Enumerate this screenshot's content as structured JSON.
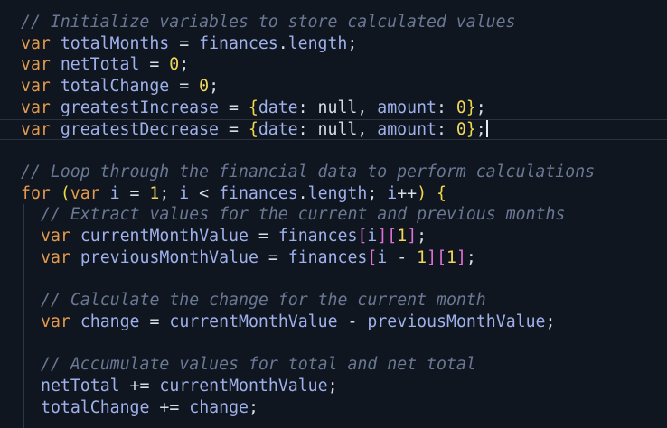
{
  "colors": {
    "background": "#0f1620",
    "keyword": "#e39a4d",
    "identifier": "#9fb0ea",
    "property": "#9fb0ea",
    "operator": "#d6dde8",
    "number": "#f0d75c",
    "punctuation": "#d6dde8",
    "comment": "#6a7893",
    "brace": "#eed84c",
    "bracket_outer": "#e070d8",
    "bracket_inner": "#58a6e6",
    "paren": "#eed84c",
    "null": "#d6dde8"
  },
  "editor": {
    "cursor_line": 6,
    "lines": [
      {
        "indent": 1,
        "tokens": [
          {
            "text": "// Initialize variables to store calculated values",
            "kind": "comment"
          }
        ]
      },
      {
        "indent": 1,
        "tokens": [
          {
            "text": "var",
            "kind": "keyword"
          },
          {
            "text": " ",
            "kind": "ws"
          },
          {
            "text": "totalMonths",
            "kind": "identifier"
          },
          {
            "text": " = ",
            "kind": "operator"
          },
          {
            "text": "finances",
            "kind": "identifier"
          },
          {
            "text": ".",
            "kind": "punctuation"
          },
          {
            "text": "length",
            "kind": "property"
          },
          {
            "text": ";",
            "kind": "punctuation"
          }
        ]
      },
      {
        "indent": 1,
        "tokens": [
          {
            "text": "var",
            "kind": "keyword"
          },
          {
            "text": " ",
            "kind": "ws"
          },
          {
            "text": "netTotal",
            "kind": "identifier"
          },
          {
            "text": " = ",
            "kind": "operator"
          },
          {
            "text": "0",
            "kind": "number"
          },
          {
            "text": ";",
            "kind": "punctuation"
          }
        ]
      },
      {
        "indent": 1,
        "tokens": [
          {
            "text": "var",
            "kind": "keyword"
          },
          {
            "text": " ",
            "kind": "ws"
          },
          {
            "text": "totalChange",
            "kind": "identifier"
          },
          {
            "text": " = ",
            "kind": "operator"
          },
          {
            "text": "0",
            "kind": "number"
          },
          {
            "text": ";",
            "kind": "punctuation"
          }
        ]
      },
      {
        "indent": 1,
        "tokens": [
          {
            "text": "var",
            "kind": "keyword"
          },
          {
            "text": " ",
            "kind": "ws"
          },
          {
            "text": "greatestIncrease",
            "kind": "identifier"
          },
          {
            "text": " = ",
            "kind": "operator"
          },
          {
            "text": "{",
            "kind": "brace"
          },
          {
            "text": "date",
            "kind": "property"
          },
          {
            "text": ": ",
            "kind": "punctuation"
          },
          {
            "text": "null",
            "kind": "null"
          },
          {
            "text": ", ",
            "kind": "punctuation"
          },
          {
            "text": "amount",
            "kind": "property"
          },
          {
            "text": ": ",
            "kind": "punctuation"
          },
          {
            "text": "0",
            "kind": "number"
          },
          {
            "text": "}",
            "kind": "brace"
          },
          {
            "text": ";",
            "kind": "punctuation"
          }
        ]
      },
      {
        "indent": 1,
        "tokens": [
          {
            "text": "var",
            "kind": "keyword"
          },
          {
            "text": " ",
            "kind": "ws"
          },
          {
            "text": "greatestDecrease",
            "kind": "identifier"
          },
          {
            "text": " = ",
            "kind": "operator"
          },
          {
            "text": "{",
            "kind": "brace"
          },
          {
            "text": "date",
            "kind": "property"
          },
          {
            "text": ": ",
            "kind": "punctuation"
          },
          {
            "text": "null",
            "kind": "null"
          },
          {
            "text": ", ",
            "kind": "punctuation"
          },
          {
            "text": "amount",
            "kind": "property"
          },
          {
            "text": ": ",
            "kind": "punctuation"
          },
          {
            "text": "0",
            "kind": "number"
          },
          {
            "text": "}",
            "kind": "brace"
          },
          {
            "text": ";",
            "kind": "punctuation"
          }
        ]
      },
      {
        "indent": 1,
        "tokens": []
      },
      {
        "indent": 1,
        "tokens": [
          {
            "text": "// Loop through the financial data to perform calculations",
            "kind": "comment"
          }
        ]
      },
      {
        "indent": 1,
        "tokens": [
          {
            "text": "for",
            "kind": "keyword"
          },
          {
            "text": " ",
            "kind": "ws"
          },
          {
            "text": "(",
            "kind": "paren"
          },
          {
            "text": "var",
            "kind": "keyword"
          },
          {
            "text": " ",
            "kind": "ws"
          },
          {
            "text": "i",
            "kind": "identifier"
          },
          {
            "text": " = ",
            "kind": "operator"
          },
          {
            "text": "1",
            "kind": "number"
          },
          {
            "text": "; ",
            "kind": "punctuation"
          },
          {
            "text": "i",
            "kind": "identifier"
          },
          {
            "text": " < ",
            "kind": "operator"
          },
          {
            "text": "finances",
            "kind": "identifier"
          },
          {
            "text": ".",
            "kind": "punctuation"
          },
          {
            "text": "length",
            "kind": "property"
          },
          {
            "text": "; ",
            "kind": "punctuation"
          },
          {
            "text": "i",
            "kind": "identifier"
          },
          {
            "text": "++",
            "kind": "operator"
          },
          {
            "text": ")",
            "kind": "paren"
          },
          {
            "text": " ",
            "kind": "ws"
          },
          {
            "text": "{",
            "kind": "brace"
          }
        ]
      },
      {
        "indent": 2,
        "tokens": [
          {
            "text": "// Extract values for the current and previous months",
            "kind": "comment"
          }
        ]
      },
      {
        "indent": 2,
        "tokens": [
          {
            "text": "var",
            "kind": "keyword"
          },
          {
            "text": " ",
            "kind": "ws"
          },
          {
            "text": "currentMonthValue",
            "kind": "identifier"
          },
          {
            "text": " = ",
            "kind": "operator"
          },
          {
            "text": "finances",
            "kind": "identifier"
          },
          {
            "text": "[",
            "kind": "bracket_outer"
          },
          {
            "text": "i",
            "kind": "identifier"
          },
          {
            "text": "]",
            "kind": "bracket_outer"
          },
          {
            "text": "[",
            "kind": "bracket_outer"
          },
          {
            "text": "1",
            "kind": "number"
          },
          {
            "text": "]",
            "kind": "bracket_outer"
          },
          {
            "text": ";",
            "kind": "punctuation"
          }
        ]
      },
      {
        "indent": 2,
        "tokens": [
          {
            "text": "var",
            "kind": "keyword"
          },
          {
            "text": " ",
            "kind": "ws"
          },
          {
            "text": "previousMonthValue",
            "kind": "identifier"
          },
          {
            "text": " = ",
            "kind": "operator"
          },
          {
            "text": "finances",
            "kind": "identifier"
          },
          {
            "text": "[",
            "kind": "bracket_outer"
          },
          {
            "text": "i",
            "kind": "identifier"
          },
          {
            "text": " - ",
            "kind": "operator"
          },
          {
            "text": "1",
            "kind": "number"
          },
          {
            "text": "]",
            "kind": "bracket_outer"
          },
          {
            "text": "[",
            "kind": "bracket_outer"
          },
          {
            "text": "1",
            "kind": "number"
          },
          {
            "text": "]",
            "kind": "bracket_outer"
          },
          {
            "text": ";",
            "kind": "punctuation"
          }
        ]
      },
      {
        "indent": 2,
        "tokens": []
      },
      {
        "indent": 2,
        "tokens": [
          {
            "text": "// Calculate the change for the current month",
            "kind": "comment"
          }
        ]
      },
      {
        "indent": 2,
        "tokens": [
          {
            "text": "var",
            "kind": "keyword"
          },
          {
            "text": " ",
            "kind": "ws"
          },
          {
            "text": "change",
            "kind": "identifier"
          },
          {
            "text": " = ",
            "kind": "operator"
          },
          {
            "text": "currentMonthValue",
            "kind": "identifier"
          },
          {
            "text": " - ",
            "kind": "operator"
          },
          {
            "text": "previousMonthValue",
            "kind": "identifier"
          },
          {
            "text": ";",
            "kind": "punctuation"
          }
        ]
      },
      {
        "indent": 2,
        "tokens": []
      },
      {
        "indent": 2,
        "tokens": [
          {
            "text": "// Accumulate values for total and net total",
            "kind": "comment"
          }
        ]
      },
      {
        "indent": 2,
        "tokens": [
          {
            "text": "netTotal",
            "kind": "identifier"
          },
          {
            "text": " += ",
            "kind": "operator"
          },
          {
            "text": "currentMonthValue",
            "kind": "identifier"
          },
          {
            "text": ";",
            "kind": "punctuation"
          }
        ]
      },
      {
        "indent": 2,
        "tokens": [
          {
            "text": "totalChange",
            "kind": "identifier"
          },
          {
            "text": " += ",
            "kind": "operator"
          },
          {
            "text": "change",
            "kind": "identifier"
          },
          {
            "text": ";",
            "kind": "punctuation"
          }
        ]
      }
    ]
  }
}
